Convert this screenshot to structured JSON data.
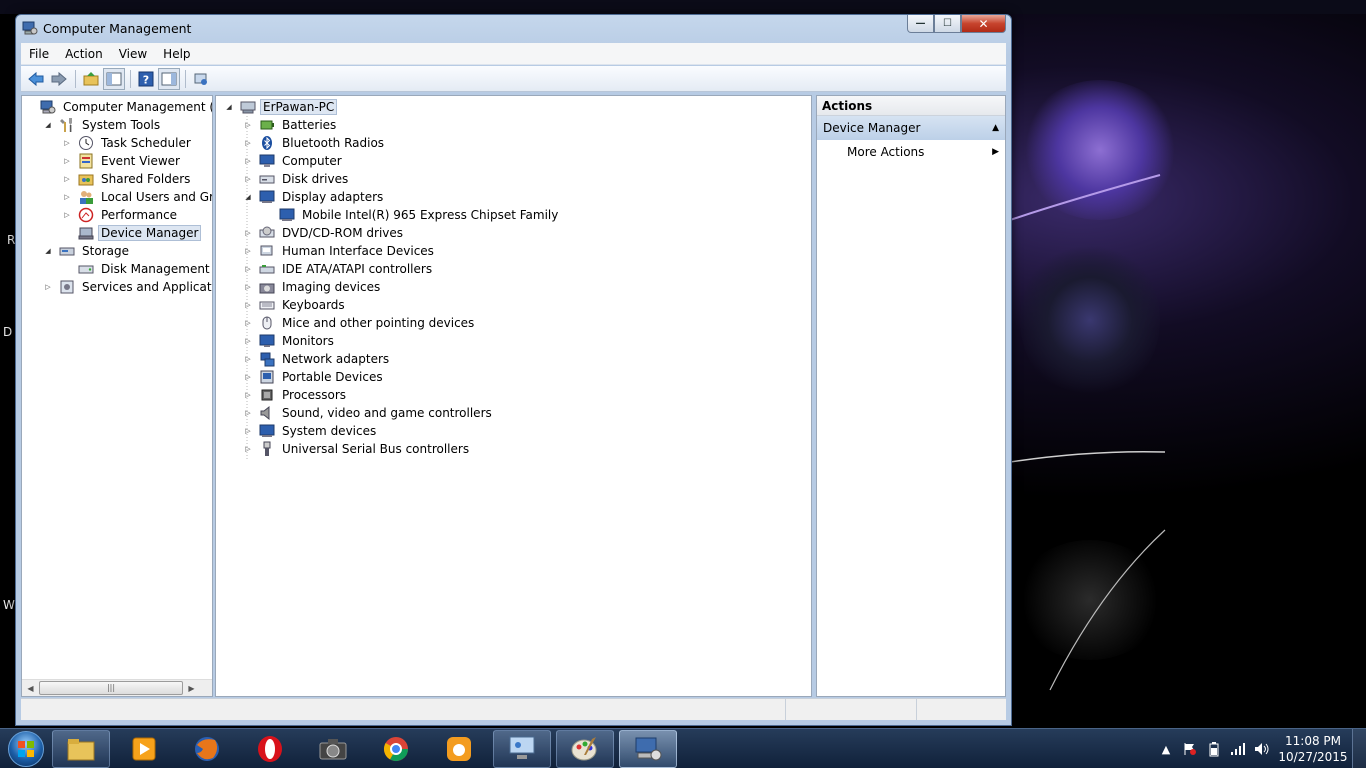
{
  "window": {
    "title": "Computer Management",
    "controls": {
      "minimize": "—",
      "maximize": "☐",
      "close": "✕"
    }
  },
  "menu": [
    "File",
    "Action",
    "View",
    "Help"
  ],
  "toolbar_icons": [
    "back-arrow-icon",
    "forward-arrow-icon",
    "up-folder-icon",
    "show-hide-console-tree-icon",
    "help-icon",
    "show-hide-action-pane-icon",
    "properties-icon"
  ],
  "left_tree": [
    {
      "label": "Computer Management (Local",
      "level": 0,
      "expander": "",
      "icon": "computer-management-icon"
    },
    {
      "label": "System Tools",
      "level": 1,
      "expander": "open",
      "icon": "system-tools-icon"
    },
    {
      "label": "Task Scheduler",
      "level": 2,
      "expander": "closed",
      "icon": "clock-icon"
    },
    {
      "label": "Event Viewer",
      "level": 2,
      "expander": "closed",
      "icon": "event-viewer-icon"
    },
    {
      "label": "Shared Folders",
      "level": 2,
      "expander": "closed",
      "icon": "shared-folders-icon"
    },
    {
      "label": "Local Users and Groups",
      "level": 2,
      "expander": "closed",
      "icon": "users-icon"
    },
    {
      "label": "Performance",
      "level": 2,
      "expander": "closed",
      "icon": "performance-icon"
    },
    {
      "label": "Device Manager",
      "level": 2,
      "expander": "",
      "icon": "device-manager-icon",
      "selected": true
    },
    {
      "label": "Storage",
      "level": 1,
      "expander": "open",
      "icon": "storage-icon"
    },
    {
      "label": "Disk Management",
      "level": 2,
      "expander": "",
      "icon": "disk-management-icon"
    },
    {
      "label": "Services and Applications",
      "level": 1,
      "expander": "closed",
      "icon": "services-icon"
    }
  ],
  "device_tree": {
    "root": "ErPawan-PC",
    "categories": [
      {
        "label": "Batteries",
        "icon": "battery-icon"
      },
      {
        "label": "Bluetooth Radios",
        "icon": "bluetooth-icon"
      },
      {
        "label": "Computer",
        "icon": "computer-icon"
      },
      {
        "label": "Disk drives",
        "icon": "disk-drive-icon"
      },
      {
        "label": "Display adapters",
        "icon": "display-adapter-icon",
        "expanded": true,
        "children": [
          "Mobile Intel(R) 965 Express Chipset Family"
        ]
      },
      {
        "label": "DVD/CD-ROM drives",
        "icon": "dvd-drive-icon"
      },
      {
        "label": "Human Interface Devices",
        "icon": "hid-icon"
      },
      {
        "label": "IDE ATA/ATAPI controllers",
        "icon": "ide-controller-icon"
      },
      {
        "label": "Imaging devices",
        "icon": "camera-icon"
      },
      {
        "label": "Keyboards",
        "icon": "keyboard-icon"
      },
      {
        "label": "Mice and other pointing devices",
        "icon": "mouse-icon"
      },
      {
        "label": "Monitors",
        "icon": "monitor-icon"
      },
      {
        "label": "Network adapters",
        "icon": "network-adapter-icon"
      },
      {
        "label": "Portable Devices",
        "icon": "portable-device-icon"
      },
      {
        "label": "Processors",
        "icon": "processor-icon"
      },
      {
        "label": "Sound, video and game controllers",
        "icon": "speaker-icon"
      },
      {
        "label": "System devices",
        "icon": "system-devices-icon"
      },
      {
        "label": "Universal Serial Bus controllers",
        "icon": "usb-icon"
      }
    ]
  },
  "actions": {
    "header": "Actions",
    "section": "Device Manager",
    "more": "More Actions"
  },
  "taskbar": {
    "apps": [
      "file-explorer-icon",
      "media-player-icon",
      "firefox-icon",
      "opera-icon",
      "camera-app-icon",
      "chrome-icon",
      "uc-browser-icon",
      "control-panel-icon",
      "paint-icon",
      "computer-management-icon"
    ],
    "clock_time": "11:08 PM",
    "clock_date": "10/27/2015"
  },
  "desktop_fragments": [
    "R",
    "D",
    "W"
  ],
  "colors": {
    "selection": "#dde6f2",
    "title_gradient": "#c5d7ec",
    "taskbar": "#1a2e4a"
  }
}
